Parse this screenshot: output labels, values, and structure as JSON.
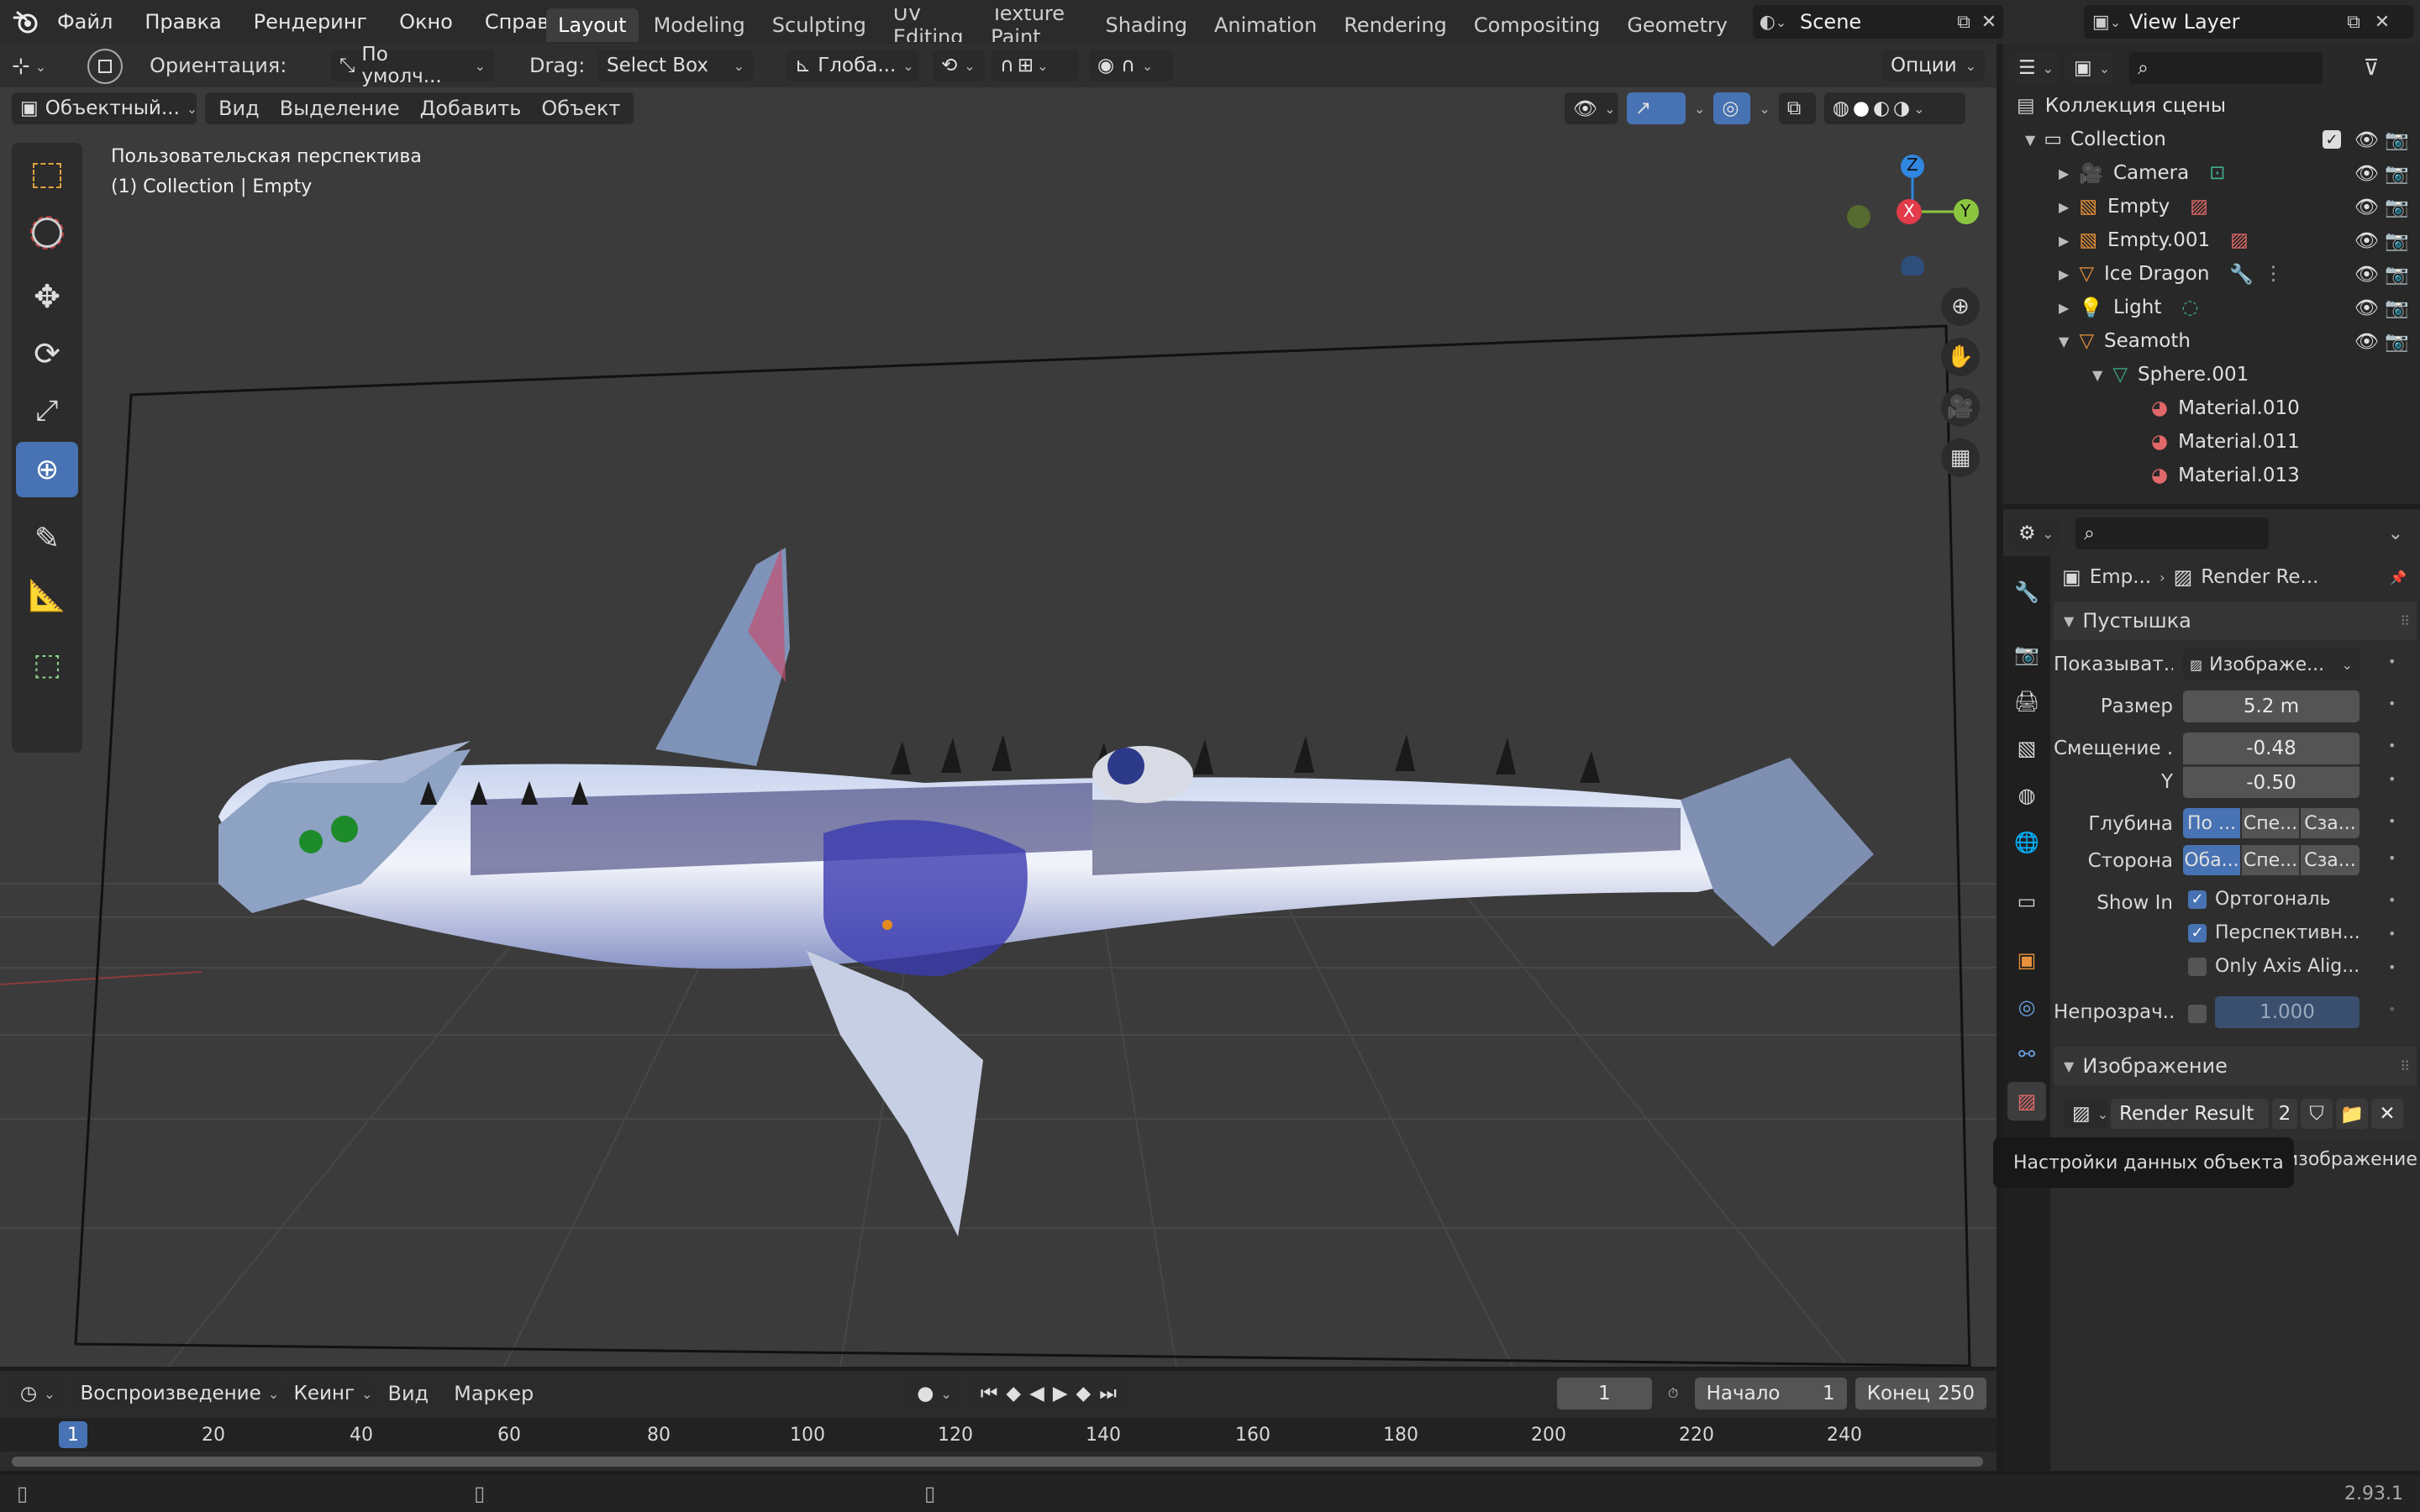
{
  "topbar": {
    "menus": [
      "Файл",
      "Правка",
      "Рендеринг",
      "Окно",
      "Справка"
    ],
    "workspaces": [
      "Layout",
      "Modeling",
      "Sculpting",
      "UV Editing",
      "Texture Paint",
      "Shading",
      "Animation",
      "Rendering",
      "Compositing",
      "Geometry"
    ],
    "scene": "Scene",
    "view_layer": "View Layer"
  },
  "viewport": {
    "orientation_label": "Ориентация:",
    "orientation_value": "По умолч...",
    "drag_label": "Drag:",
    "drag_value": "Select Box",
    "transform_value": "Глоба...",
    "options_label": "Опции",
    "mode": "Объектный...",
    "menu": [
      "Вид",
      "Выделение",
      "Добавить",
      "Объект"
    ],
    "overlay_title": "Пользовательская перспектива",
    "overlay_sub": "(1) Collection | Empty",
    "gizmo": {
      "z": "Z",
      "x": "X",
      "y": "Y"
    }
  },
  "outliner": {
    "scene_collection": "Коллекция сцены",
    "collection": "Collection",
    "items": [
      {
        "name": "Camera"
      },
      {
        "name": "Empty"
      },
      {
        "name": "Empty.001"
      },
      {
        "name": "Ice Dragon"
      },
      {
        "name": "Light"
      },
      {
        "name": "Seamoth"
      }
    ],
    "sub": "Sphere.001",
    "materials": [
      "Material.010",
      "Material.011",
      "Material.013"
    ]
  },
  "properties": {
    "breadcrumb_obj": "Emp...",
    "breadcrumb_data": "Render Re...",
    "section_empty": "Пустышка",
    "display_label": "Показыват...",
    "display_value": "Изображе...",
    "size_label": "Размер",
    "size_value": "5.2 m",
    "offset_label": "Смещение ...",
    "offset_x": "-0.48",
    "y_label": "Y",
    "offset_y": "-0.50",
    "depth_label": "Глубина",
    "depth_opts": [
      "По ...",
      "Спе...",
      "Сза..."
    ],
    "side_label": "Сторона",
    "side_opts": [
      "Оба...",
      "Спе...",
      "Сза..."
    ],
    "show_in_label": "Show In",
    "show_ortho": "Ортогональ",
    "show_persp": "Перспективн...",
    "only_axis": "Only Axis Alig...",
    "opacity_label": "Непрозрач...",
    "opacity_value": "1.000",
    "section_image": "Изображение",
    "image_name": "Render Result",
    "image_users": "2",
    "error_text": "Не удалось загрузить изображение",
    "tooltip": "Настройки данных объекта"
  },
  "timeline": {
    "playback": "Воспроизведение",
    "keying": "Кеинг",
    "view": "Вид",
    "marker": "Маркер",
    "current_frame": "1",
    "start_label": "Начало",
    "start": "1",
    "end_label": "Конец",
    "end": "250",
    "ticks": [
      "1",
      "20",
      "40",
      "60",
      "80",
      "100",
      "120",
      "140",
      "160",
      "180",
      "200",
      "220",
      "240"
    ]
  },
  "status": {
    "version": "2.93.1"
  },
  "colors": {
    "accent": "#4772b3",
    "x_axis": "#e23b4a",
    "y_axis": "#8bc53f",
    "z_axis": "#2f87e0"
  }
}
